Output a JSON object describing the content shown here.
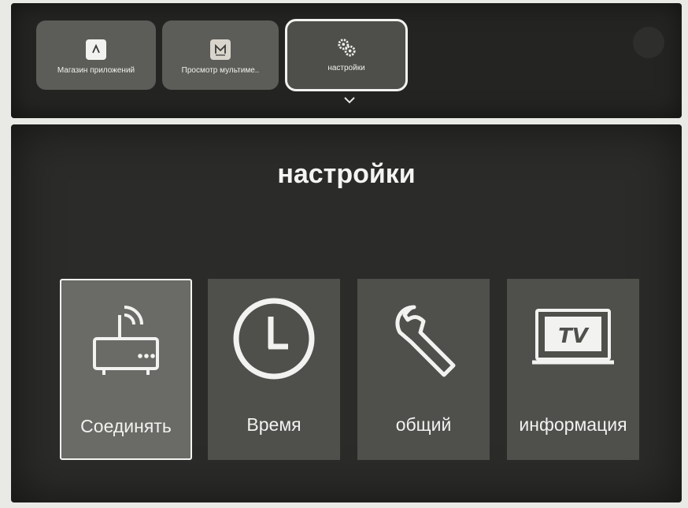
{
  "top_apps": [
    {
      "label": "Магазин приложений",
      "icon": "store-icon"
    },
    {
      "label": "Просмотр мультиме..",
      "icon": "media-icon"
    },
    {
      "label": "настройки",
      "icon": "gears-icon",
      "selected": true
    }
  ],
  "main": {
    "title": "настройки",
    "cards": [
      {
        "label": "Соединять",
        "icon": "router-icon",
        "selected": true
      },
      {
        "label": "Время",
        "icon": "clock-icon"
      },
      {
        "label": "общий",
        "icon": "wrench-icon"
      },
      {
        "label": "информация",
        "icon": "tv-icon"
      }
    ]
  }
}
